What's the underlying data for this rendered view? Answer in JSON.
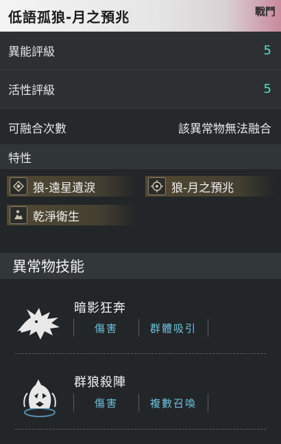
{
  "header": {
    "title": "低語孤狼-月之預兆",
    "tag": "戰鬥"
  },
  "stats": [
    {
      "label": "異能評級",
      "value": "5"
    },
    {
      "label": "活性評級",
      "value": "5"
    },
    {
      "label": "可融合次數",
      "value": "該異常物無法融合"
    }
  ],
  "traits": {
    "label": "特性",
    "items": [
      {
        "label": "狼-遠星遺淚",
        "icon": "diamond-star-icon"
      },
      {
        "label": "狼-月之預兆",
        "icon": "crosshair-icon"
      },
      {
        "label": "乾淨衛生",
        "icon": "figure-icon"
      }
    ]
  },
  "skills": {
    "title": "異常物技能",
    "items": [
      {
        "name": "暗影狂奔",
        "icon": "shadow-wolf-icon",
        "tags": [
          "傷害",
          "群體吸引"
        ]
      },
      {
        "name": "群狼殺陣",
        "icon": "wolf-circle-icon",
        "tags": [
          "傷害",
          "複數召喚"
        ]
      }
    ]
  },
  "colors": {
    "accent_teal": "#56e0c6",
    "tag_blue": "#6fc3df"
  }
}
